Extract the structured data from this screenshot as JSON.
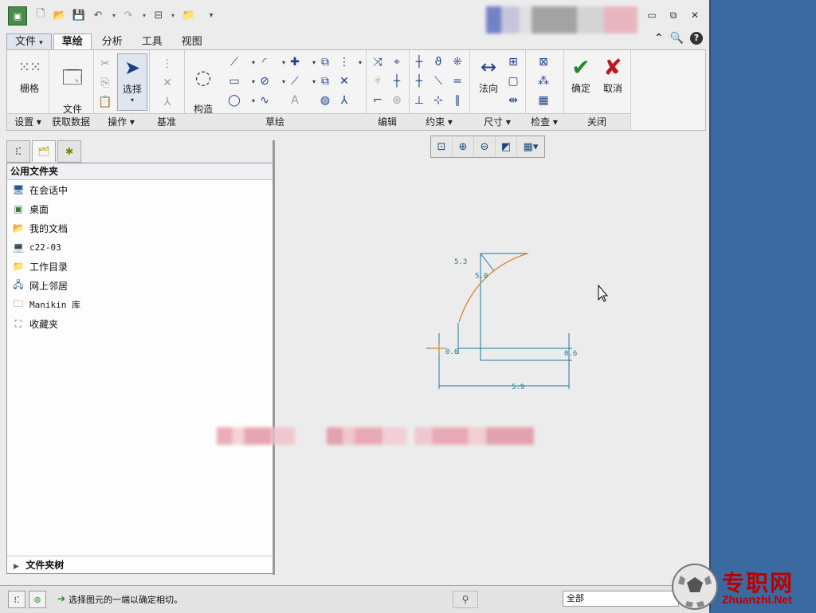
{
  "ribbon_tabs": [
    {
      "label": "文件",
      "name": "tab-file"
    },
    {
      "label": "草绘",
      "name": "tab-sketch"
    },
    {
      "label": "分析",
      "name": "tab-analysis"
    },
    {
      "label": "工具",
      "name": "tab-tools"
    },
    {
      "label": "视图",
      "name": "tab-view"
    }
  ],
  "ribbon": {
    "grid_label": "栅格",
    "filesystem_label": "文件\n系统",
    "select_label": "选择",
    "construct_label": "构造\n模式",
    "normal_label": "法向",
    "ok_label": "确定",
    "cancel_label": "取消",
    "groups": [
      "设置",
      "获取数据",
      "操作",
      "基准",
      "草绘",
      "编辑",
      "约束",
      "尺寸",
      "检查",
      "关闭"
    ]
  },
  "folders": {
    "header": "公用文件夹",
    "items": [
      "在会话中",
      "桌面",
      "我的文档",
      "c22-03",
      "工作目录",
      "网上邻居",
      "Manikin 库",
      "收藏夹"
    ],
    "footer": "文件夹树"
  },
  "sketch": {
    "dims": [
      "5.3",
      "5.0",
      "0.6",
      "0.6",
      "5.9"
    ]
  },
  "status": {
    "message": "选择图元的一端以确定相切。",
    "filter": "全部"
  },
  "watermark": {
    "cn": "专职网",
    "en": "Zhuanzhi.Net"
  },
  "colors": {
    "sketch_dim": "#1f7a9a",
    "sketch_arc": "#d08a2a",
    "accent": "#1b3f8a",
    "ok": "#1e8a2a",
    "cancel": "#c0161c"
  }
}
